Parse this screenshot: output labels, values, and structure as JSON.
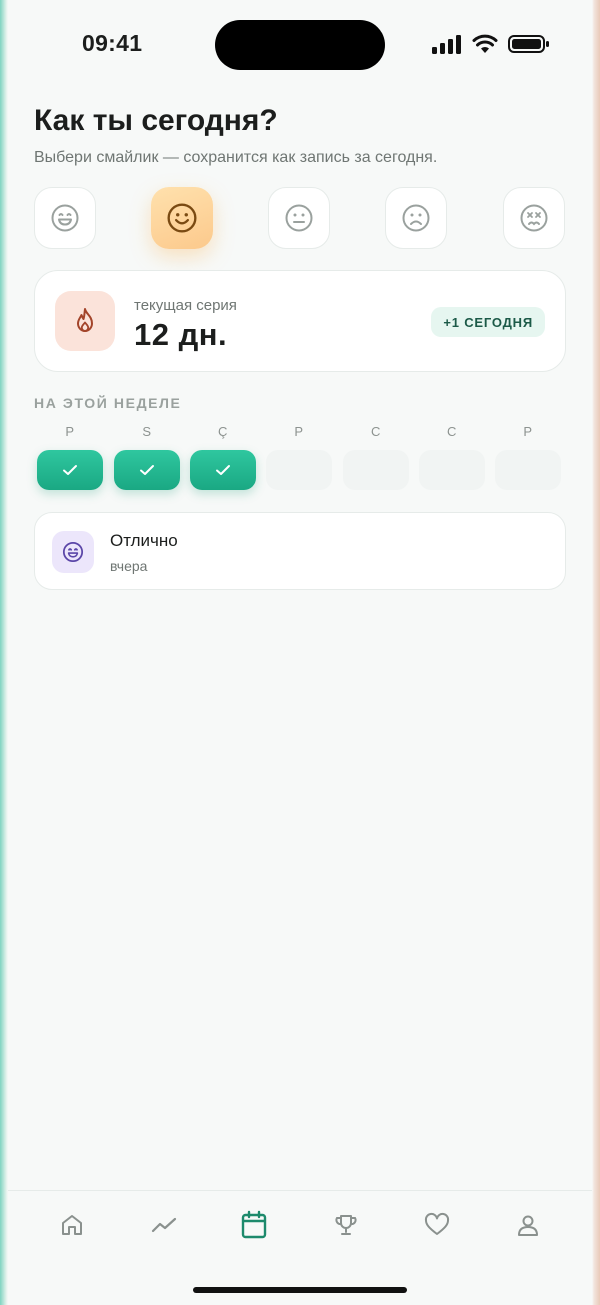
{
  "status_bar": {
    "time": "09:41"
  },
  "header": {
    "title": "Как ты сегодня?",
    "subtitle": "Выбери смайлик — сохранится как запись за сегодня."
  },
  "moods": [
    {
      "icon": "grin-face-icon",
      "selected": false
    },
    {
      "icon": "smile-face-icon",
      "selected": true
    },
    {
      "icon": "neutral-face-icon",
      "selected": false
    },
    {
      "icon": "sad-face-icon",
      "selected": false
    },
    {
      "icon": "dizzy-face-icon",
      "selected": false
    }
  ],
  "streak": {
    "icon": "flame-icon",
    "label": "текущая серия",
    "value": "12 дн.",
    "badge": "+1 СЕГОДНЯ"
  },
  "week": {
    "label": "НА ЭТОЙ НЕДЕЛЕ",
    "days": [
      {
        "letter": "P",
        "done": true
      },
      {
        "letter": "S",
        "done": true
      },
      {
        "letter": "Ç",
        "done": true
      },
      {
        "letter": "P",
        "done": false
      },
      {
        "letter": "C",
        "done": false
      },
      {
        "letter": "C",
        "done": false
      },
      {
        "letter": "P",
        "done": false
      }
    ]
  },
  "recent_entry": {
    "icon": "grin-face-icon",
    "title": "Отлично",
    "subtitle": "вчера"
  },
  "tabbar": {
    "items": [
      {
        "icon": "home-icon",
        "active": false
      },
      {
        "icon": "trend-icon",
        "active": false
      },
      {
        "icon": "calendar-icon",
        "active": true
      },
      {
        "icon": "trophy-icon",
        "active": false
      },
      {
        "icon": "heart-icon",
        "active": false
      },
      {
        "icon": "user-icon",
        "active": false
      }
    ]
  },
  "colors": {
    "accent": "#1d8a6c",
    "streak_bg": "#fbe3da",
    "selected_mood": "#fcc98c"
  }
}
